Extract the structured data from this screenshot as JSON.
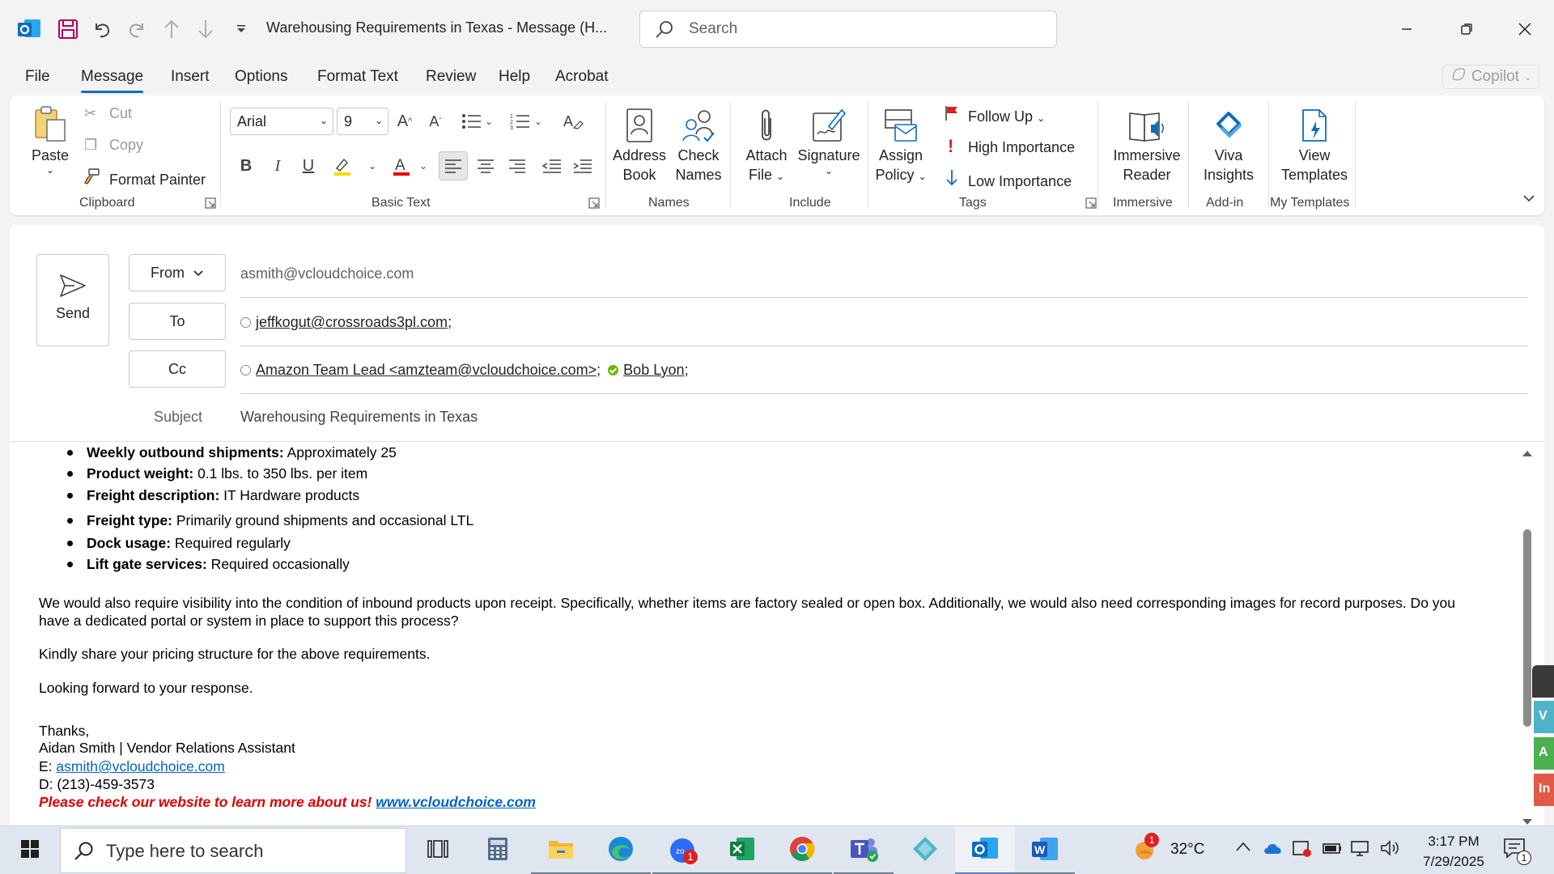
{
  "titlebar": {
    "window_title": "Warehousing Requirements in Texas  -  Message (H...",
    "search_placeholder": "Search",
    "icons": [
      "outlook-icon",
      "save-icon",
      "undo-icon",
      "redo-icon",
      "up-arrow-icon",
      "down-arrow-icon",
      "customize-icon",
      "minimize-icon",
      "restore-icon",
      "close-icon"
    ]
  },
  "menu": {
    "tabs": [
      "File",
      "Message",
      "Insert",
      "Options",
      "Format Text",
      "Review",
      "Help",
      "Acrobat"
    ],
    "active_tab": "Message",
    "copilot_label": "Copilot"
  },
  "ribbon": {
    "clipboard": {
      "label": "Clipboard",
      "paste": "Paste",
      "cut": "Cut",
      "copy": "Copy",
      "format_painter": "Format Painter"
    },
    "basic_text": {
      "label": "Basic Text",
      "font_name": "Arial",
      "font_size": "9"
    },
    "names": {
      "label": "Names",
      "address_book": [
        "Address",
        "Book"
      ],
      "check_names": [
        "Check",
        "Names"
      ]
    },
    "include": {
      "label": "Include",
      "attach_file": [
        "Attach",
        "File"
      ],
      "signature": "Signature"
    },
    "tags": {
      "label": "Tags",
      "assign_policy": [
        "Assign",
        "Policy"
      ],
      "follow_up": "Follow Up",
      "high_importance": "High Importance",
      "low_importance": "Low Importance"
    },
    "immersive": {
      "label": "Immersive",
      "immersive_reader": [
        "Immersive",
        "Reader"
      ]
    },
    "addin": {
      "label": "Add-in",
      "viva_insights": [
        "Viva",
        "Insights"
      ]
    },
    "templates": {
      "label": "My Templates",
      "view_templates": [
        "View",
        "Templates"
      ]
    },
    "colors": {
      "highlight": "#ffd700",
      "font_color": "#e00000",
      "accent": "#0f6cbd"
    }
  },
  "compose": {
    "send_label": "Send",
    "from_label": "From",
    "from_value": "asmith@vcloudchoice.com",
    "to_label": "To",
    "to_recipients": [
      {
        "text": "jeffkogut@crossroads3pl.com",
        "presence": "unknown"
      }
    ],
    "cc_label": "Cc",
    "cc_recipients": [
      {
        "text": "Amazon Team Lead <amzteam@vcloudchoice.com>",
        "presence": "unknown"
      },
      {
        "text": "Bob Lyon",
        "presence": "available"
      }
    ],
    "subject_label": "Subject",
    "subject_value": "Warehousing Requirements in Texas"
  },
  "body": {
    "bullets": [
      {
        "label": "Weekly outbound shipments:",
        "value": " Approximately 25"
      },
      {
        "label": "Product weight:",
        "value": " 0.1 lbs. to 350 lbs. per item"
      },
      {
        "label": "Freight description:",
        "value": " IT Hardware products"
      },
      {
        "label": "Freight type:",
        "value": " Primarily ground shipments and occasional LTL"
      },
      {
        "label": "Dock usage:",
        "value": " Required regularly"
      },
      {
        "label": "Lift gate services:",
        "value": " Required occasionally"
      }
    ],
    "paragraph1_line1": "We would also require visibility into the condition of inbound products upon receipt. Specifically, whether items are factory sealed or open box. Additionally, we would also need corresponding images for record purposes. Do you",
    "paragraph1_line2": "have a dedicated portal or system in place to support this process?",
    "paragraph2": "Kindly share your pricing structure for the above requirements.",
    "paragraph3": "Looking forward to your response.",
    "signature": {
      "thanks": "Thanks,",
      "name_title": "Aidan Smith | Vendor Relations Assistant",
      "email_prefix": "E: ",
      "email": "asmith@vcloudchoice.com",
      "phone": "D: (213)-459-3573",
      "promo": "Please check our website to learn more about us! ",
      "website": "www.vcloudchoice.com"
    }
  },
  "side_tabs": [
    {
      "letter": "V",
      "color": "#4fb3c8"
    },
    {
      "letter": "A",
      "color": "#4caf50"
    },
    {
      "letter": "In",
      "color": "#e05a47"
    }
  ],
  "taskbar": {
    "search_placeholder": "Type here to search",
    "apps": [
      "task-view",
      "calculator",
      "file-explorer",
      "edge",
      "zoom",
      "excel",
      "chrome",
      "teams",
      "unknown-app",
      "outlook",
      "word"
    ],
    "zoom_badge": "1",
    "weather_badge": "1",
    "temperature": "32°C",
    "time": "3:17 PM",
    "date": "7/29/2025",
    "notification_count": "1"
  }
}
